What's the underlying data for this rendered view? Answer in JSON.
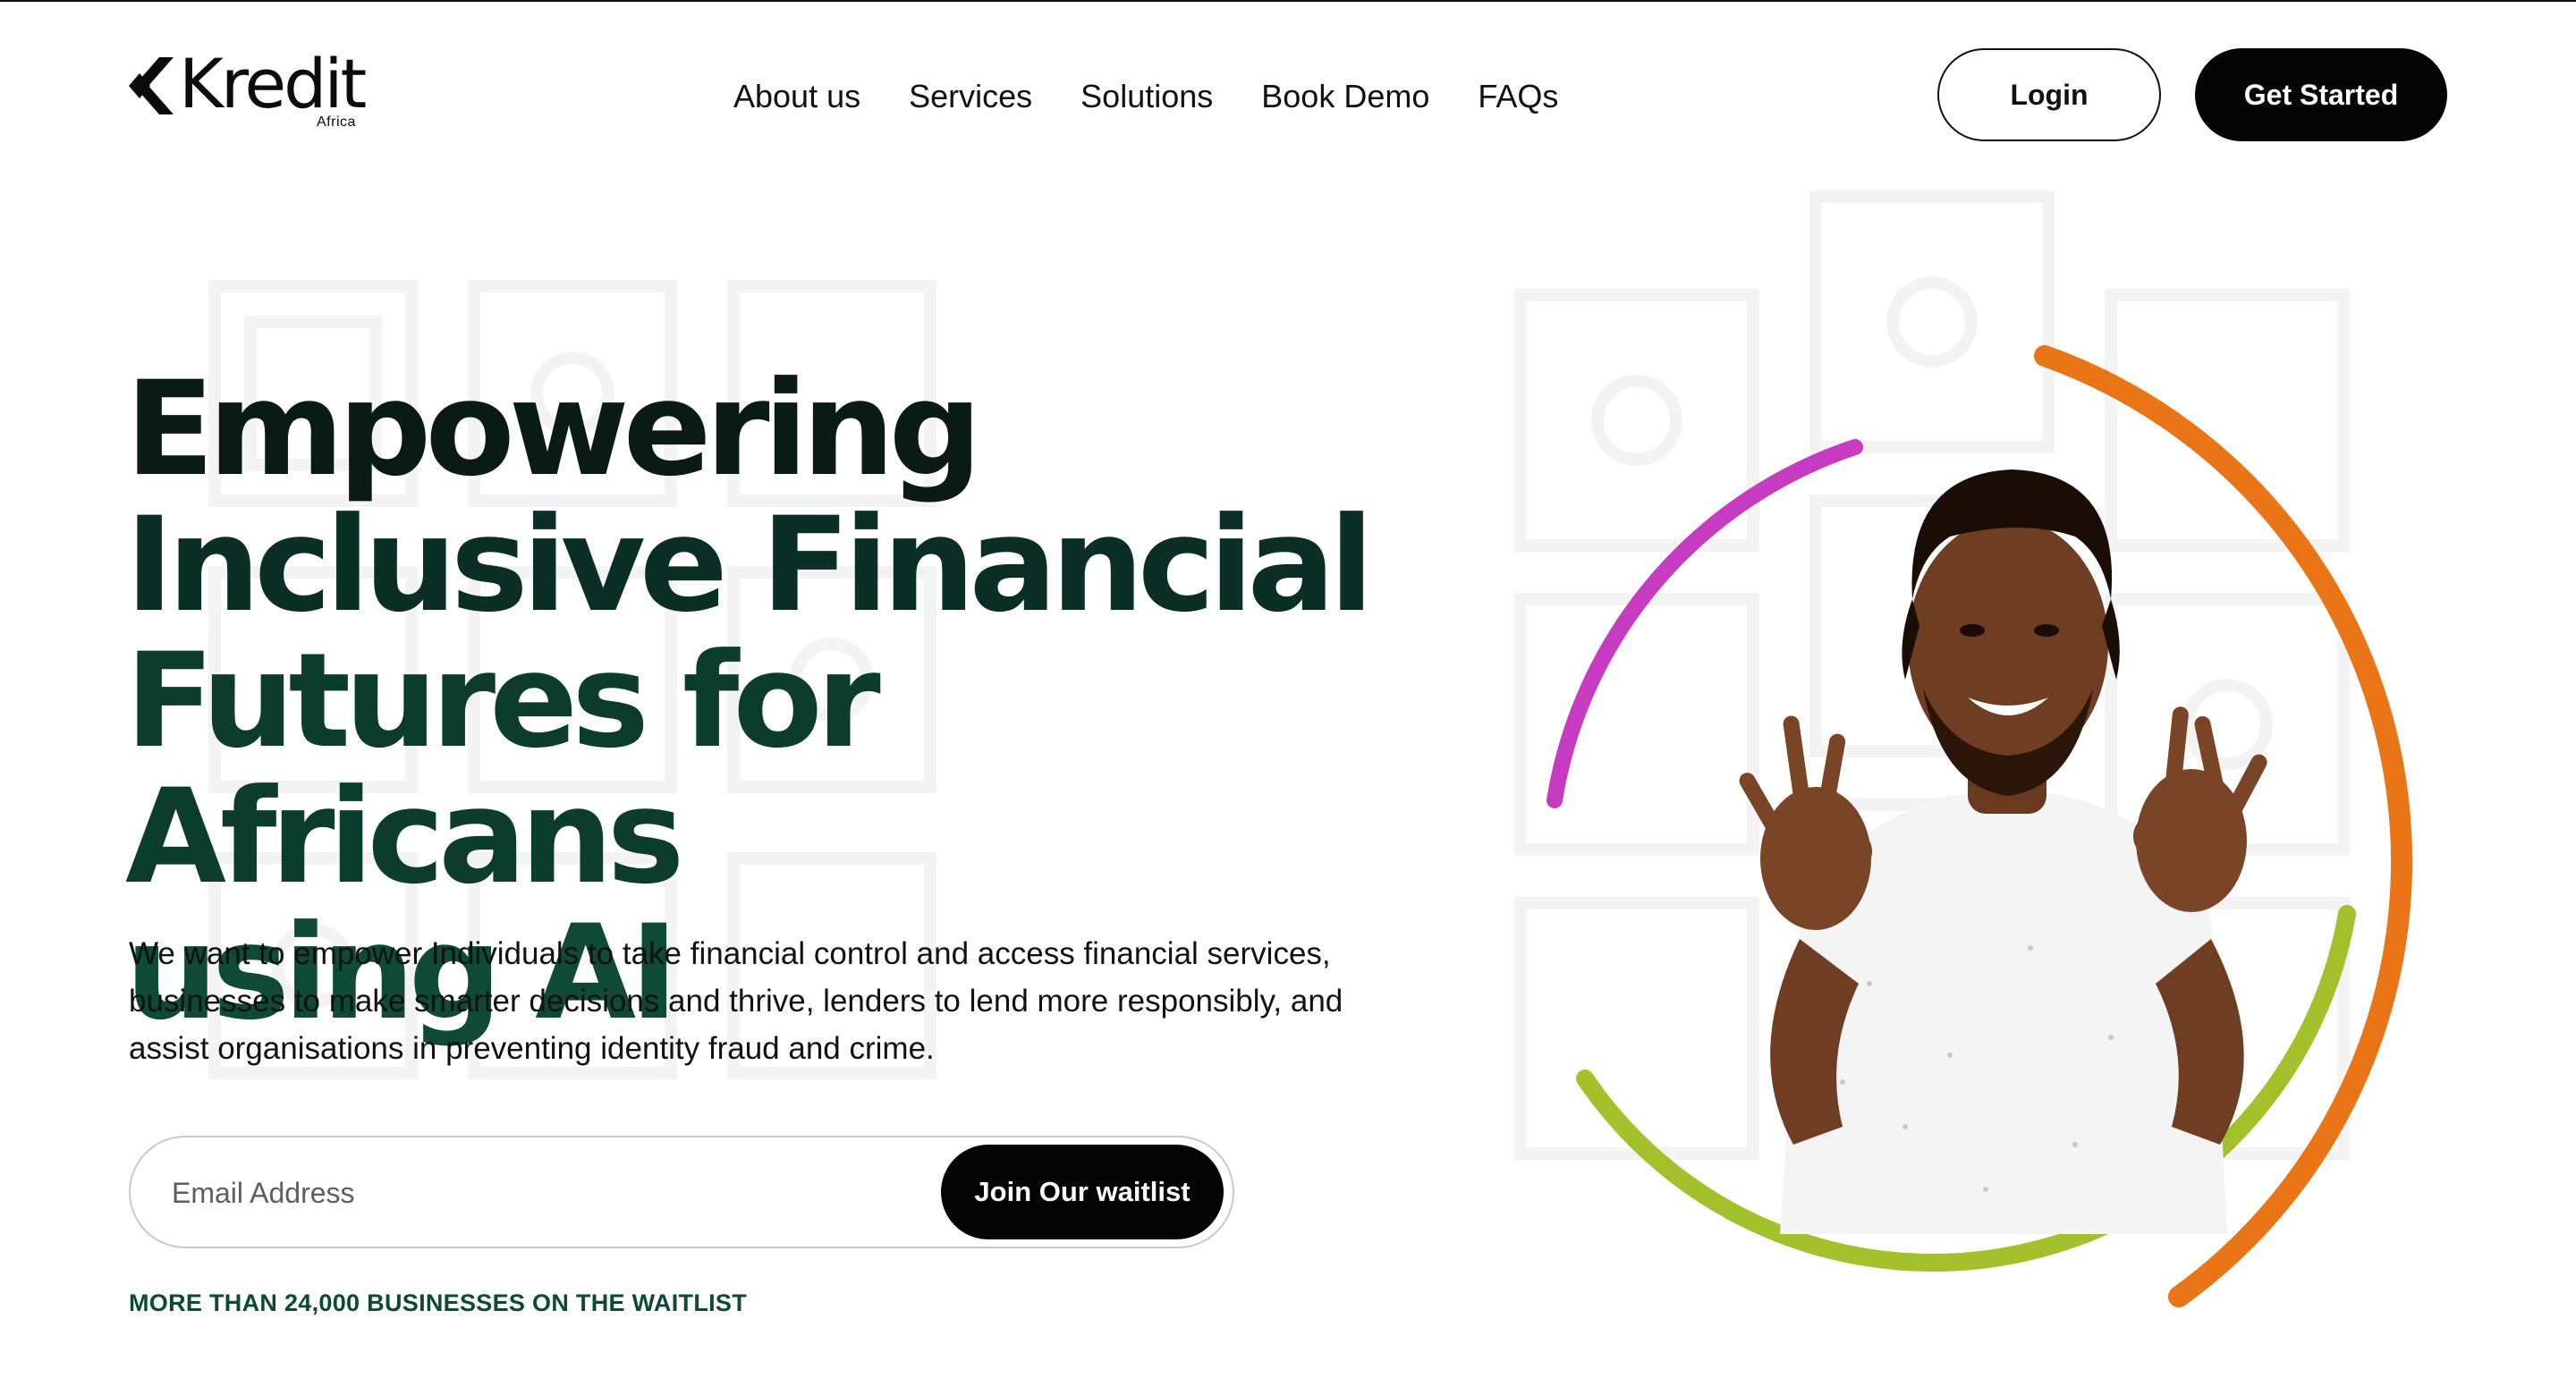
{
  "brand": {
    "name": "Kredit",
    "sub": "Africa"
  },
  "nav": {
    "links": [
      "About us",
      "Services",
      "Solutions",
      "Book Demo",
      "FAQs"
    ],
    "login_label": "Login",
    "cta_label": "Get Started"
  },
  "hero": {
    "headline": [
      "Empowering",
      "Inclusive Financial",
      "Futures for Africans",
      "using AI"
    ],
    "description": "We want to empower Individuals to take financial control and access financial services, businesses to make smarter decisions and thrive, lenders to lend more responsibly, and assist organisations in preventing identity fraud and crime.",
    "email_placeholder": "Email Address",
    "join_label": "Join Our waitlist",
    "waitlist_note": "MORE THAN 24,000 BUSINESSES ON THE WAITLIST"
  },
  "colors": {
    "headline_dark": "#0a1a14",
    "headline_green": "#0f4a36",
    "arc_magenta": "#c63bbf",
    "arc_orange": "#ea7517",
    "arc_lime": "#a3c12b",
    "button_dark": "#050505"
  }
}
